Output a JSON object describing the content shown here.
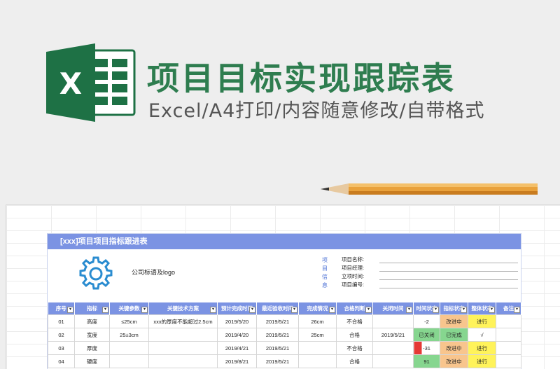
{
  "banner": {
    "title": "项目目标实现跟踪表",
    "subtitle": "Excel/A4打印/内容随意修改/自带格式",
    "logo_letter": "X",
    "logo_icon": "excel-logo-icon",
    "colors": {
      "title": "#2e7d4f",
      "excel_green": "#1e7145"
    }
  },
  "sheet": {
    "header_title": "[xxx]项目项目指标跟进表",
    "brand_text": "公司标语及logo",
    "gear_icon": "gear-icon",
    "project_info_label": [
      "项",
      "目",
      "信",
      "息"
    ],
    "info_fields": [
      "项目名称:",
      "项目经理:",
      "立项时间:",
      "项目编号:"
    ],
    "columns": [
      "序号",
      "指标",
      "关键参数",
      "关键技术方案",
      "预计完成时间",
      "最近验收时间",
      "完成情况",
      "合格判断",
      "关闭时间",
      "时间状态",
      "指标状态",
      "整体状态",
      "备注"
    ],
    "rows": [
      {
        "no": "01",
        "metric": "高度",
        "param": "≤25cm",
        "plan": "xxx的厚度不能超过2.5cm",
        "expected": "2019/5/20",
        "latest": "2019/5/21",
        "progress": "26cm",
        "judge": "不合格",
        "closed": "",
        "time": "-2",
        "metric_status": "改进中",
        "overall": "进行",
        "remark": ""
      },
      {
        "no": "02",
        "metric": "宽度",
        "param": "25±3cm",
        "plan": "",
        "expected": "2019/4/20",
        "latest": "2019/5/21",
        "progress": "25cm",
        "judge": "合格",
        "closed": "2019/5/21",
        "time": "已关闭",
        "metric_status": "已完成",
        "overall": "√",
        "remark": ""
      },
      {
        "no": "03",
        "metric": "厚度",
        "param": "",
        "plan": "",
        "expected": "2019/4/21",
        "latest": "2019/5/21",
        "progress": "",
        "judge": "不合格",
        "closed": "",
        "time": "-31",
        "metric_status": "改进中",
        "overall": "进行",
        "remark": ""
      },
      {
        "no": "04",
        "metric": "硬度",
        "param": "",
        "plan": "",
        "expected": "2019/8/21",
        "latest": "2019/5/21",
        "progress": "",
        "judge": "合格",
        "closed": "",
        "time": "91",
        "metric_status": "改进中",
        "overall": "进行",
        "remark": ""
      }
    ]
  }
}
